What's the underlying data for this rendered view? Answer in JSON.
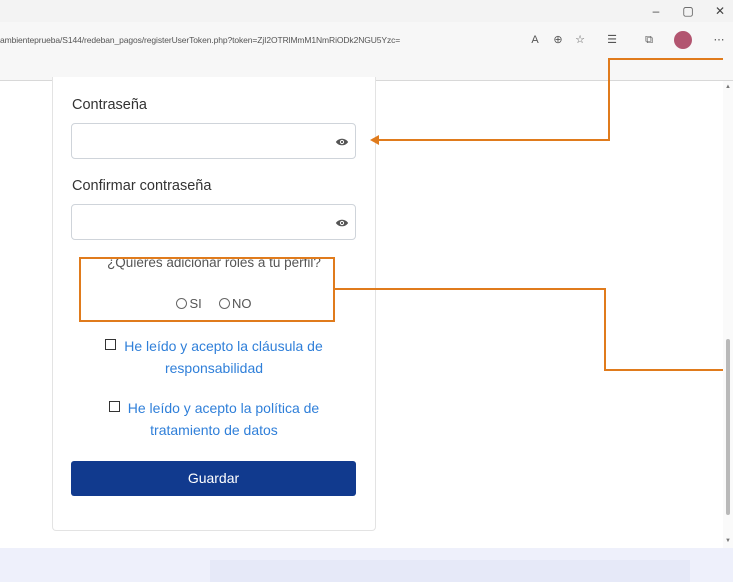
{
  "browser": {
    "url": "ambienteprueba/S144/redeban_pagos/registerUserToken.php?token=ZjI2OTRlMmM1NmRiODk2NGU5Yzc=",
    "window_controls": [
      "–",
      "▢",
      "✕"
    ]
  },
  "form": {
    "password_label": "Contraseña",
    "confirm_password_label": "Confirmar contraseña",
    "roles_question": "¿Quieres adicionar roles a tu perfil?",
    "role_options": [
      "SI",
      "NO"
    ],
    "terms_line1": "He leído y acepto la cláusula de",
    "terms_line2": "responsabilidad",
    "privacy_line1": "He leído y acepto la política de",
    "privacy_line2": "tratamiento de datos",
    "save_label": "Guardar"
  },
  "colors": {
    "primary_button": "#113a8e",
    "link": "#2f7fd9",
    "annotation": "#e07b1c"
  },
  "icons": [
    "eye-icon",
    "read-aloud-icon",
    "zoom-icon",
    "favorite-add-icon",
    "favorites-icon",
    "collections-icon",
    "more-icon"
  ]
}
